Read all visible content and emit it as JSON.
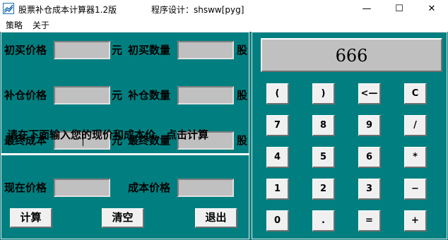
{
  "window": {
    "title": "股票补仓成本计算器1.2版",
    "designer": "程序设计：shsww[pyg]",
    "controls": {
      "minimize": "—",
      "maximize": "☐",
      "close": "✕"
    }
  },
  "menu": [
    "策略",
    "关于"
  ],
  "form": {
    "initial_price_label": "初买价格",
    "initial_qty_label": "初买数量",
    "add_price_label": "补仓价格",
    "add_qty_label": "补仓数量",
    "final_cost_label": "最终成本",
    "final_qty_label": "最终数量",
    "unit_yuan": "元",
    "unit_shares": "股",
    "instruction": "请在下面输入您的现价和成本价，点击计算",
    "current_price_label": "现在价格",
    "cost_price_label": "成本价格",
    "values": {
      "initial_price": "",
      "initial_qty": "",
      "add_price": "",
      "add_qty": "",
      "final_cost": "",
      "final_qty": "",
      "current_price": "",
      "cost_price": ""
    }
  },
  "actions": {
    "calculate": "计算",
    "clear": "清空",
    "exit": "退出"
  },
  "calculator": {
    "display": "666",
    "keys": [
      [
        "(",
        ")",
        "<—",
        "C"
      ],
      [
        "7",
        "8",
        "9",
        "/"
      ],
      [
        "4",
        "5",
        "6",
        "*"
      ],
      [
        "1",
        "2",
        "3",
        "−"
      ],
      [
        "0",
        ".",
        "=",
        "+"
      ]
    ]
  },
  "colors": {
    "background": "#017f80",
    "field": "#c0c0c0",
    "button": "#f0f0f0"
  },
  "icons": [
    "app-icon",
    "minimize-icon",
    "maximize-icon",
    "close-icon"
  ]
}
